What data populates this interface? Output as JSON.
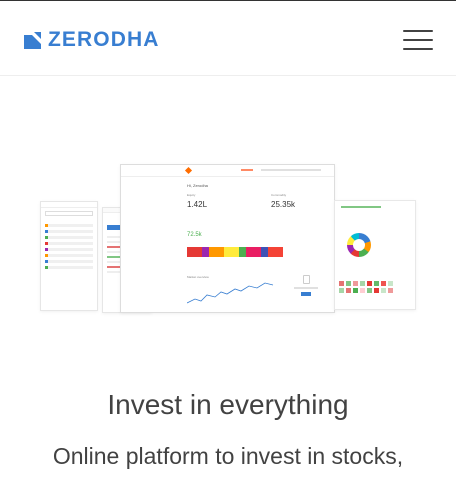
{
  "header": {
    "brand": "ZERODHA",
    "brand_color": "#387ed1",
    "menu_icon": "hamburger-menu-icon"
  },
  "hero": {
    "image_icon": "platform-screens-illustration",
    "dashboard": {
      "greeting": "Hi, Zerodha",
      "equity_label": "Equity",
      "equity_value": "1.42L",
      "commodity_label": "Commodity",
      "commodity_value": "25.35k",
      "holdings_value": "72.5k",
      "market_overview_label": "Market overview"
    },
    "colors": {
      "positive": "#4caf50",
      "negative": "#e53935",
      "accent": "#387ed1",
      "orange": "#ff6d00"
    }
  },
  "content": {
    "title": "Invest in everything",
    "subtitle": "Online platform to invest in stocks,"
  }
}
